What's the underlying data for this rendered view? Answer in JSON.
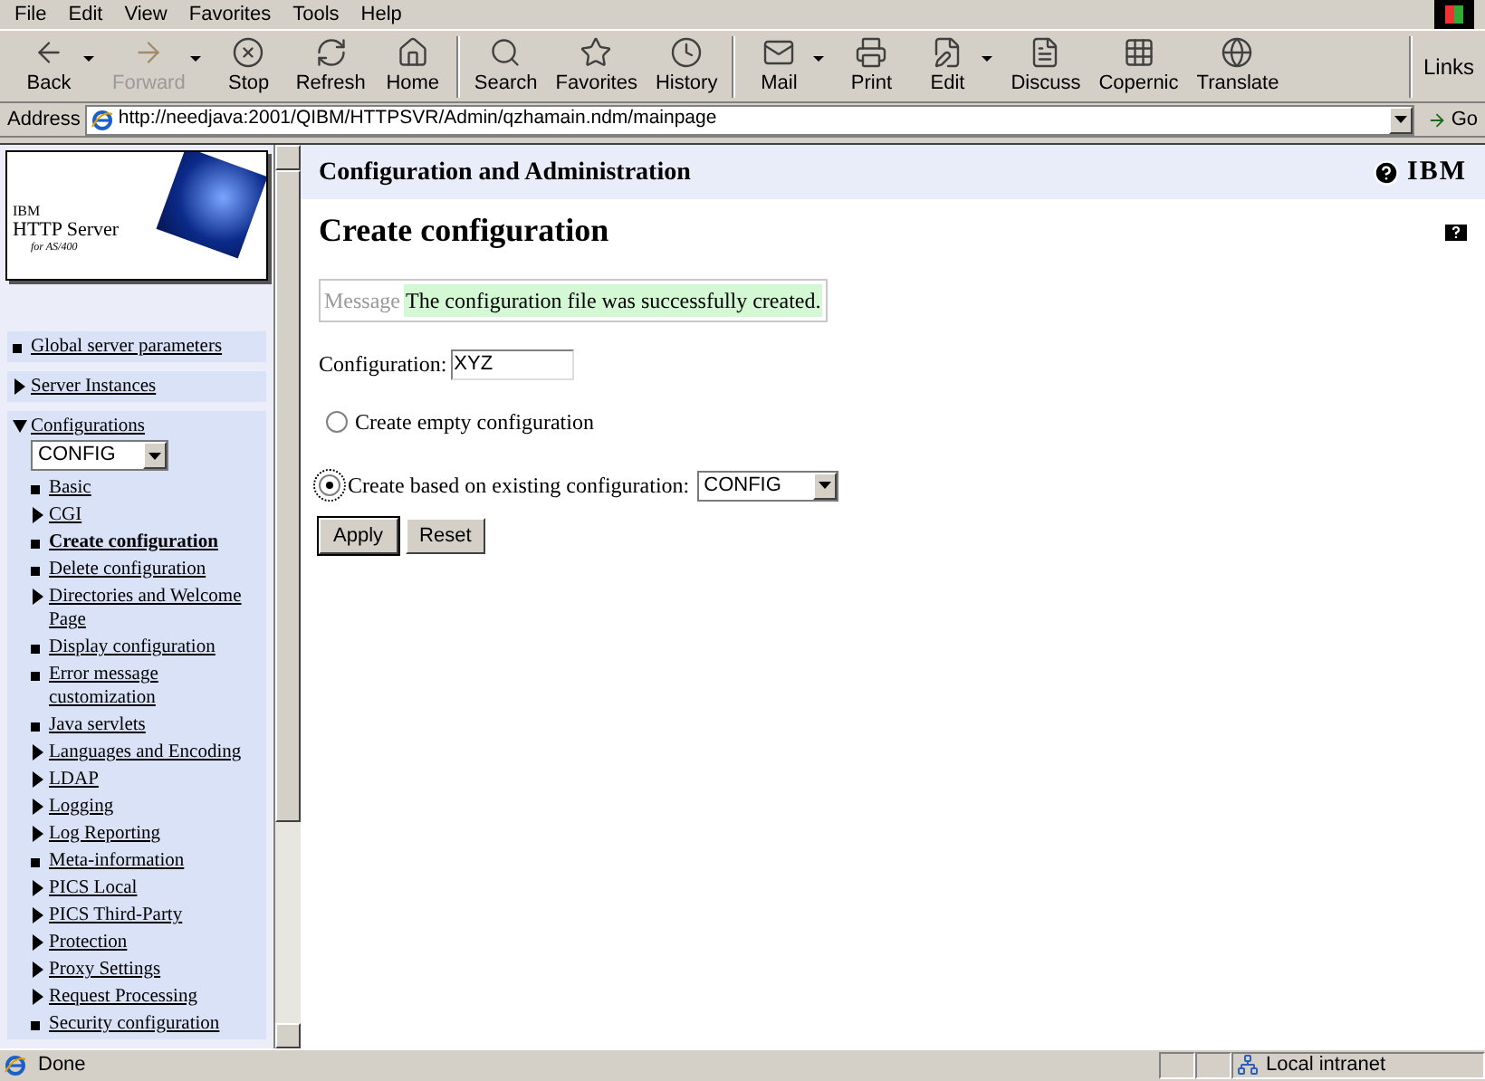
{
  "menu": [
    {
      "label": "File"
    },
    {
      "label": "Edit"
    },
    {
      "label": "View"
    },
    {
      "label": "Favorites"
    },
    {
      "label": "Tools"
    },
    {
      "label": "Help"
    }
  ],
  "toolbar": [
    {
      "label": "Back",
      "disabled": false,
      "has_menu": true,
      "kind": "back"
    },
    {
      "label": "Forward",
      "disabled": true,
      "has_menu": true,
      "kind": "forward"
    },
    {
      "label": "Stop",
      "disabled": false,
      "has_menu": false,
      "kind": "stop"
    },
    {
      "label": "Refresh",
      "disabled": false,
      "has_menu": false,
      "kind": "refresh"
    },
    {
      "label": "Home",
      "disabled": false,
      "has_menu": false,
      "kind": "home"
    },
    {
      "label": "Search",
      "disabled": false,
      "has_menu": false,
      "kind": "search"
    },
    {
      "label": "Favorites",
      "disabled": false,
      "has_menu": false,
      "kind": "favorites"
    },
    {
      "label": "History",
      "disabled": false,
      "has_menu": false,
      "kind": "history"
    },
    {
      "label": "Mail",
      "disabled": false,
      "has_menu": true,
      "kind": "mail"
    },
    {
      "label": "Print",
      "disabled": false,
      "has_menu": false,
      "kind": "print"
    },
    {
      "label": "Edit",
      "disabled": false,
      "has_menu": true,
      "kind": "edit"
    },
    {
      "label": "Discuss",
      "disabled": false,
      "has_menu": false,
      "kind": "discuss"
    },
    {
      "label": "Copernic",
      "disabled": false,
      "has_menu": false,
      "kind": "copernic"
    },
    {
      "label": "Translate",
      "disabled": false,
      "has_menu": false,
      "kind": "translate"
    }
  ],
  "links_label": "Links",
  "address": {
    "label": "Address",
    "value": "http://needjava:2001/QIBM/HTTPSVR/Admin/qzhamain.ndm/mainpage",
    "go": "Go"
  },
  "logo": {
    "line1": "IBM",
    "line2": "HTTP Server",
    "line3": "for AS/400"
  },
  "sidebar": [
    {
      "label": "Global server parameters",
      "kind": "bullet"
    },
    {
      "label": "Server Instances",
      "kind": "arrow",
      "expanded": false
    },
    {
      "label": "Configurations",
      "kind": "arrow",
      "expanded": true,
      "select": "CONFIG",
      "children": [
        {
          "label": "Basic",
          "kind": "bullet",
          "selected": false
        },
        {
          "label": "CGI",
          "kind": "arrow",
          "selected": false
        },
        {
          "label": "Create configuration",
          "kind": "bullet",
          "selected": true
        },
        {
          "label": "Delete configuration",
          "kind": "bullet",
          "selected": false
        },
        {
          "label": "Directories and Welcome Page",
          "kind": "arrow",
          "selected": false
        },
        {
          "label": "Display configuration",
          "kind": "bullet",
          "selected": false
        },
        {
          "label": "Error message customization",
          "kind": "bullet",
          "selected": false
        },
        {
          "label": "Java servlets",
          "kind": "bullet",
          "selected": false
        },
        {
          "label": "Languages and Encoding",
          "kind": "arrow",
          "selected": false
        },
        {
          "label": "LDAP",
          "kind": "arrow",
          "selected": false
        },
        {
          "label": "Logging",
          "kind": "arrow",
          "selected": false
        },
        {
          "label": "Log Reporting",
          "kind": "arrow",
          "selected": false
        },
        {
          "label": "Meta-information",
          "kind": "bullet",
          "selected": false
        },
        {
          "label": "PICS Local",
          "kind": "arrow",
          "selected": false
        },
        {
          "label": "PICS Third-Party",
          "kind": "arrow",
          "selected": false
        },
        {
          "label": "Protection",
          "kind": "arrow",
          "selected": false
        },
        {
          "label": "Proxy Settings",
          "kind": "arrow",
          "selected": false
        },
        {
          "label": "Request Processing",
          "kind": "arrow",
          "selected": false
        },
        {
          "label": "Security configuration",
          "kind": "bullet",
          "selected": false
        }
      ]
    }
  ],
  "header": {
    "title": "Configuration and Administration",
    "brand": "IBM"
  },
  "page": {
    "title": "Create configuration",
    "message": {
      "label": "Message",
      "text": "The configuration file was successfully created."
    },
    "configuration": {
      "label": "Configuration:",
      "value": "XYZ"
    },
    "options": [
      {
        "label": "Create empty configuration",
        "selected": false
      },
      {
        "label": "Create based on existing configuration:",
        "selected": true,
        "select": "CONFIG"
      }
    ],
    "buttons": [
      {
        "label": "Apply"
      },
      {
        "label": "Reset"
      }
    ]
  },
  "status": {
    "text": "Done",
    "zone": "Local intranet"
  }
}
